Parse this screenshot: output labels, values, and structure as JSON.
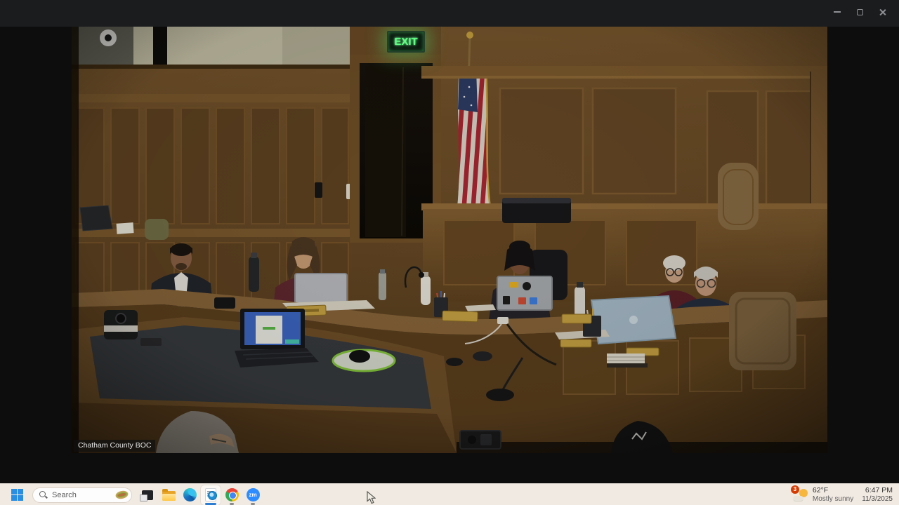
{
  "window": {
    "controls": [
      "minimize-icon",
      "maximize-icon",
      "close-icon"
    ]
  },
  "video": {
    "caption": "Chatham County BOC",
    "exit_sign_text": "EXIT",
    "scene_palette": {
      "wood_mid": "#6b4c28",
      "wood_dark": "#4a3318",
      "wood_light": "#8a6335",
      "cream_wall": "#c5c1a9",
      "exit_green": "#5fff82",
      "flag_red": "#b22234",
      "flag_blue": "#2b3a66",
      "laptop_screen_blue": "#3a66c4"
    }
  },
  "taskbar": {
    "search_placeholder": "Search",
    "apps": [
      "task-view",
      "file-explorer",
      "edge",
      "document-viewer",
      "chrome",
      "zoom"
    ],
    "zoom_label": "zm",
    "tray": {
      "badge": "3",
      "temperature": "62°F",
      "condition": "Mostly sunny",
      "time": "6:47 PM",
      "date": "11/3/2025"
    }
  }
}
